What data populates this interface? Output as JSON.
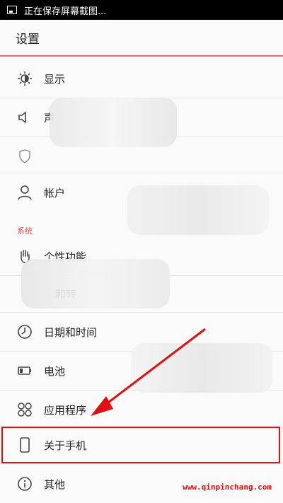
{
  "status_bar": {
    "text": "正在保存屏幕截图..."
  },
  "app_bar": {
    "title": "设置"
  },
  "items": [
    {
      "label": "显示",
      "icon": "brightness-icon"
    },
    {
      "label": "声",
      "icon": "volume-icon"
    },
    {
      "label": "帐户",
      "icon": "person-icon"
    }
  ],
  "section": {
    "label": "系统"
  },
  "system_items": [
    {
      "label": "个性功能",
      "icon": "hand-icon"
    },
    {
      "label": "和转",
      "icon": "accessibility-icon"
    },
    {
      "label": "日期和时间",
      "icon": "clock-icon"
    },
    {
      "label": "电池",
      "icon": "battery-icon"
    },
    {
      "label": "应用程序",
      "icon": "apps-icon"
    },
    {
      "label": "关于手机",
      "icon": "phone-icon"
    },
    {
      "label": "其他",
      "icon": "info-icon"
    }
  ],
  "watermark": "www.qinpinchang.com",
  "colors": {
    "accent": "#e36a6a",
    "highlight": "#e01010"
  }
}
